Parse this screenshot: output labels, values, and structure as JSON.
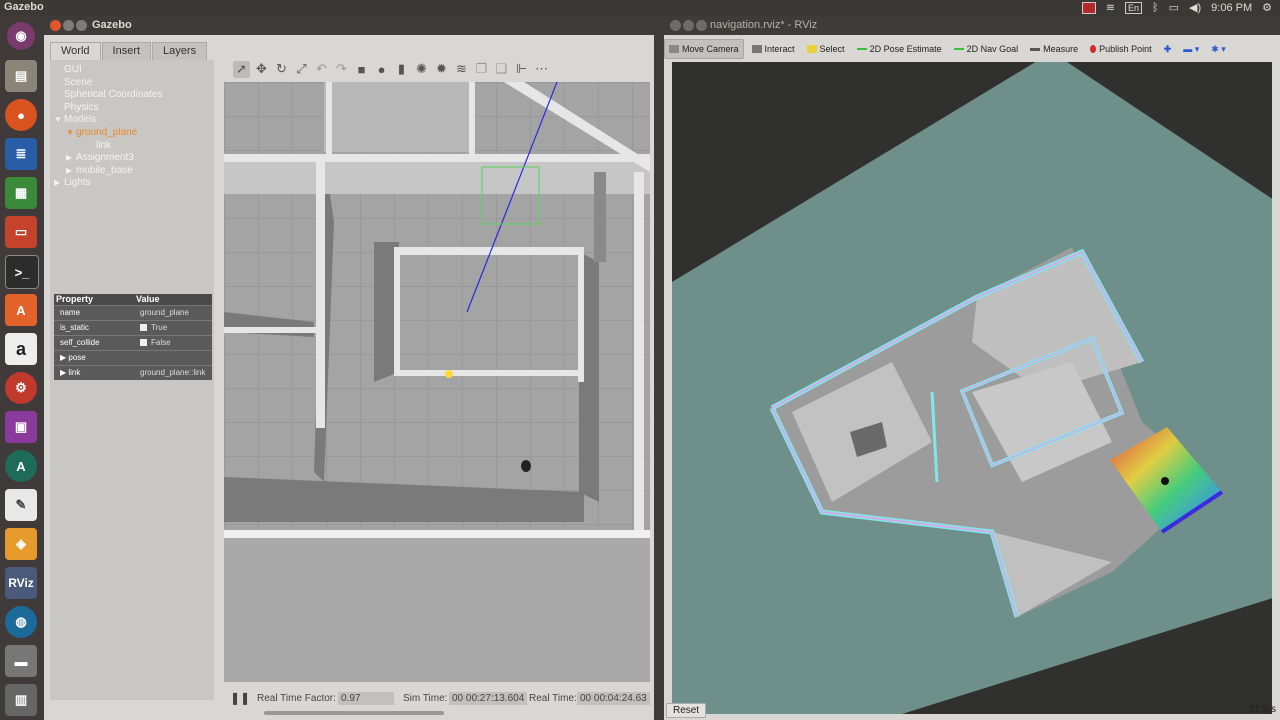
{
  "topbar": {
    "app_name": "Gazebo",
    "lang": "En",
    "time": "9:06 PM"
  },
  "launcher": {
    "icons": [
      "ubuntu-dash-icon",
      "files-icon",
      "firefox-icon",
      "writer-icon",
      "calc-icon",
      "impress-icon",
      "terminal-icon",
      "software-center-icon",
      "amazon-icon",
      "settings-icon",
      "screenshot-icon",
      "update-manager-icon",
      "text-editor-icon",
      "virtualbox-icon",
      "rviz-icon",
      "globe-icon",
      "drive-icon",
      "trash-icon"
    ],
    "rviz_label": "RViz",
    "amazon_label": "a",
    "software_label": "A"
  },
  "gazebo": {
    "title": "Gazebo",
    "tabs": [
      {
        "label": "World"
      },
      {
        "label": "Insert"
      },
      {
        "label": "Layers"
      }
    ],
    "tree": [
      {
        "label": "GUI",
        "indent": 0,
        "arrow": ""
      },
      {
        "label": "Scene",
        "indent": 0,
        "arrow": ""
      },
      {
        "label": "Spherical Coordinates",
        "indent": 0,
        "arrow": ""
      },
      {
        "label": "Physics",
        "indent": 0,
        "arrow": ""
      },
      {
        "label": "Models",
        "indent": 0,
        "arrow": "▼"
      },
      {
        "label": "ground_plane",
        "indent": 1,
        "arrow": "▼"
      },
      {
        "label": "link",
        "indent": 2,
        "arrow": ""
      },
      {
        "label": "Assignment3",
        "indent": 1,
        "arrow": "▶"
      },
      {
        "label": "mobile_base",
        "indent": 1,
        "arrow": "▶"
      },
      {
        "label": "Lights",
        "indent": 0,
        "arrow": "▶"
      }
    ],
    "properties": {
      "header_property": "Property",
      "header_value": "Value",
      "rows": [
        {
          "key": "name",
          "value": "ground_plane"
        },
        {
          "key": "is_static",
          "value": "True"
        },
        {
          "key": "self_collide",
          "value": "False"
        },
        {
          "key": "pose",
          "value": ""
        },
        {
          "key": "link",
          "value": "ground_plane::link"
        }
      ]
    },
    "bottom": {
      "rtf_label": "Real Time Factor:",
      "rtf_value": "0.97",
      "sim_label": "Sim Time:",
      "sim_value": "00 00:27:13.604",
      "real_label": "Real Time:",
      "real_value": "00 00:04:24.63"
    }
  },
  "rviz": {
    "title": "navigation.rviz* - RViz",
    "tools": [
      {
        "label": "Move Camera",
        "icon": "move-camera-icon",
        "active": true
      },
      {
        "label": "Interact",
        "icon": "interact-icon",
        "active": false
      },
      {
        "label": "Select",
        "icon": "select-icon",
        "active": false
      },
      {
        "label": "2D Pose Estimate",
        "icon": "pose-estimate-icon",
        "active": false
      },
      {
        "label": "2D Nav Goal",
        "icon": "nav-goal-icon",
        "active": false
      },
      {
        "label": "Measure",
        "icon": "measure-icon",
        "active": false
      },
      {
        "label": "Publish Point",
        "icon": "publish-point-icon",
        "active": false
      }
    ],
    "reset_label": "Reset",
    "fps": "31 fps"
  },
  "colors": {
    "map_bg": "#6f8f8a",
    "costmap_edge": "#7fe8e8",
    "inflation": "#d7a8e8",
    "gazebo_floor": "#a9a9a9"
  }
}
